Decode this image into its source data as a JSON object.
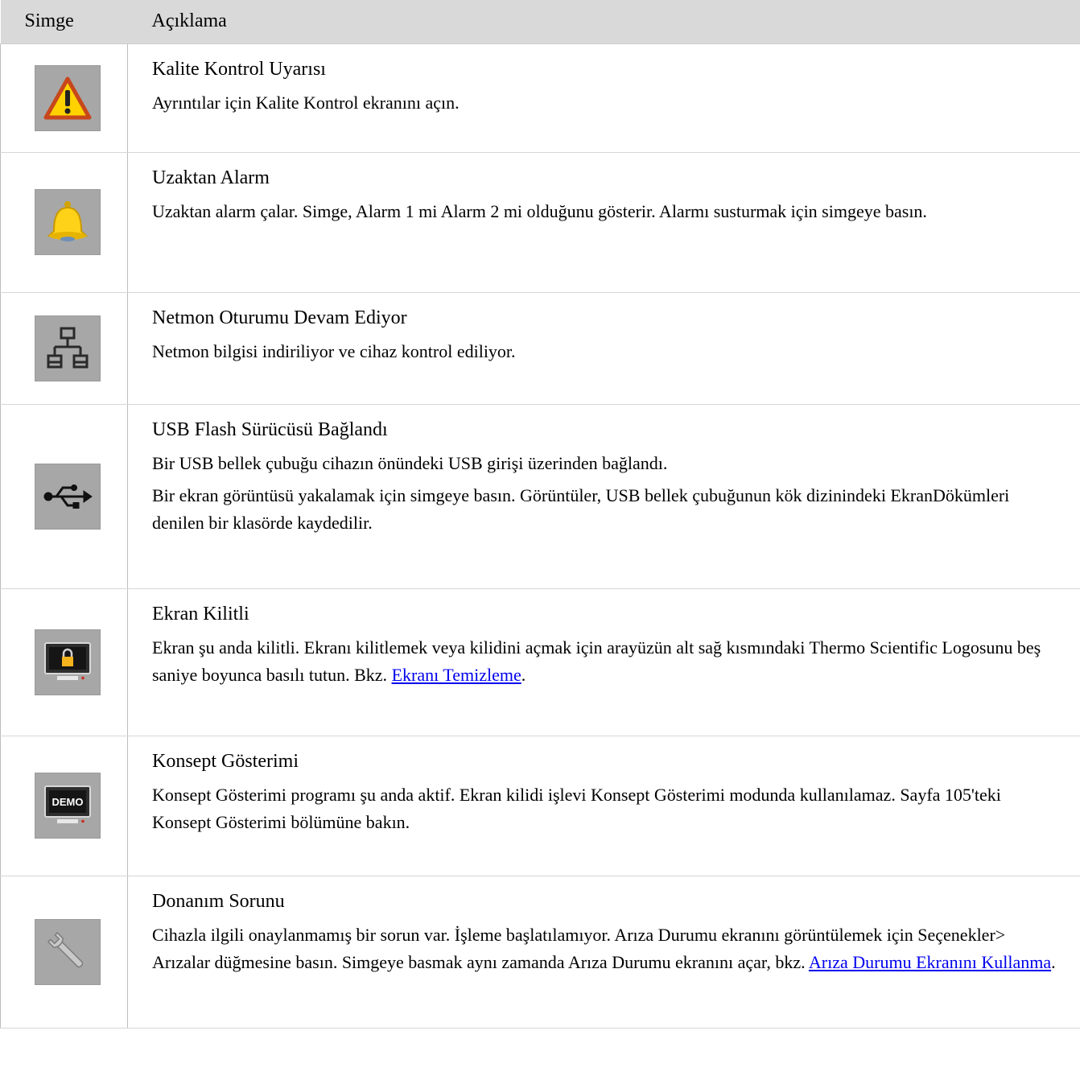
{
  "header": {
    "col_icon": "Simge",
    "col_desc": "Açıklama"
  },
  "rows": [
    {
      "icon": "warning-triangle-icon",
      "title": "Kalite Kontrol Uyarısı",
      "paragraphs": [
        "Ayrıntılar için Kalite Kontrol ekranını açın."
      ]
    },
    {
      "icon": "bell-icon",
      "title": "Uzaktan Alarm",
      "paragraphs": [
        "Uzaktan alarm çalar. Simge, Alarm 1 mi Alarm 2 mi olduğunu gösterir. Alarmı susturmak için simgeye basın."
      ]
    },
    {
      "icon": "network-icon",
      "title": "Netmon Oturumu Devam Ediyor",
      "paragraphs": [
        "Netmon bilgisi indiriliyor ve cihaz kontrol ediliyor."
      ]
    },
    {
      "icon": "usb-icon",
      "title": "USB Flash Sürücüsü Bağlandı",
      "paragraphs": [
        "Bir USB bellek çubuğu cihazın önündeki USB girişi üzerinden bağlandı.",
        "Bir ekran görüntüsü yakalamak için simgeye basın. Görüntüler, USB bellek çubuğunun kök dizinindeki EkranDökümleri denilen bir klasörde kaydedilir."
      ]
    },
    {
      "icon": "screen-lock-icon",
      "title": "Ekran Kilitli",
      "text_before_link": "Ekran şu anda kilitli. Ekranı kilitlemek veya kilidini açmak için arayüzün alt sağ kısmındaki Thermo Scientific Logosunu beş saniye boyunca basılı tutun. Bkz. ",
      "link": "Ekranı Temizleme",
      "text_after_link": "."
    },
    {
      "icon": "demo-icon",
      "title": "Konsept Gösterimi",
      "paragraphs": [
        "Konsept Gösterimi programı şu anda aktif. Ekran kilidi işlevi Konsept Gösterimi modunda kullanılamaz. Sayfa 105'teki Konsept Gösterimi bölümüne bakın."
      ],
      "icon_label": "DEMO"
    },
    {
      "icon": "wrench-icon",
      "title": "Donanım Sorunu",
      "text_before_link": "Cihazla ilgili onaylanmamış bir sorun var. İşleme başlatılamıyor. Arıza Durumu ekranını görüntülemek için Seçenekler> Arızalar düğmesine basın. Simgeye basmak aynı zamanda Arıza Durumu ekranını açar, bkz. ",
      "link": "Arıza Durumu Ekranını Kullanma",
      "text_after_link": "."
    }
  ]
}
